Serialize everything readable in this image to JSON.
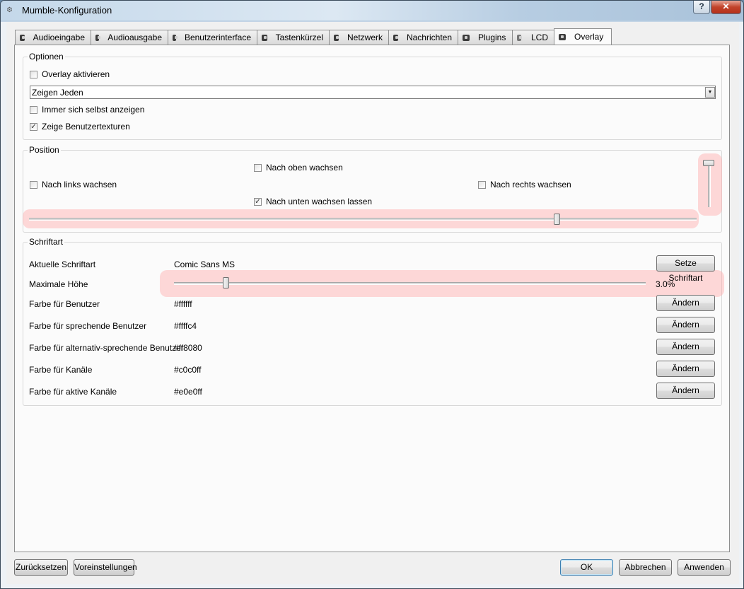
{
  "window": {
    "title": "Mumble-Konfiguration",
    "help": "?",
    "close": "✕"
  },
  "tabs": [
    {
      "label": "Audioeingabe"
    },
    {
      "label": "Audioausgabe"
    },
    {
      "label": "Benutzerinterface"
    },
    {
      "label": "Tastenkürzel"
    },
    {
      "label": "Netzwerk"
    },
    {
      "label": "Nachrichten"
    },
    {
      "label": "Plugins"
    },
    {
      "label": "LCD"
    },
    {
      "label": "Overlay",
      "active": true
    }
  ],
  "options": {
    "title": "Optionen",
    "enable_overlay": {
      "label": "Overlay aktivieren",
      "checked": false
    },
    "show_select": {
      "value": "Zeigen Jeden"
    },
    "always_self": {
      "label": "Immer sich selbst anzeigen",
      "checked": false
    },
    "user_textures": {
      "label": "Zeige Benutzertexturen",
      "checked": true
    }
  },
  "position": {
    "title": "Position",
    "grow_up": {
      "label": "Nach oben wachsen",
      "checked": false
    },
    "grow_left": {
      "label": "Nach links wachsen",
      "checked": false
    },
    "grow_right": {
      "label": "Nach rechts wachsen",
      "checked": false
    },
    "grow_down": {
      "label": "Nach unten wachsen lassen",
      "checked": true
    },
    "horizontal_level": 0.79,
    "vertical_level": 0.04
  },
  "font": {
    "title": "Schriftart",
    "current_label": "Aktuelle Schriftart",
    "current_value": "Comic Sans MS",
    "set_button": "Setze Schriftart",
    "max_height_label": "Maximale Höhe",
    "max_height_value": "3.0%",
    "max_height_level": 0.11,
    "colors": [
      {
        "label": "Farbe für Benutzer",
        "value": "#ffffff",
        "button": "Ändern"
      },
      {
        "label": "Farbe für sprechende Benutzer",
        "value": "#ffffc4",
        "button": "Ändern"
      },
      {
        "label": "Farbe für alternativ-sprechende Benutzer",
        "value": "#ff8080",
        "button": "Ändern"
      },
      {
        "label": "Farbe für Kanäle",
        "value": "#c0c0ff",
        "button": "Ändern"
      },
      {
        "label": "Farbe für aktive Kanäle",
        "value": "#e0e0ff",
        "button": "Ändern"
      }
    ]
  },
  "footer": {
    "reset": "Zurücksetzen",
    "defaults": "Voreinstellungen",
    "ok": "OK",
    "cancel": "Abbrechen",
    "apply": "Anwenden"
  }
}
